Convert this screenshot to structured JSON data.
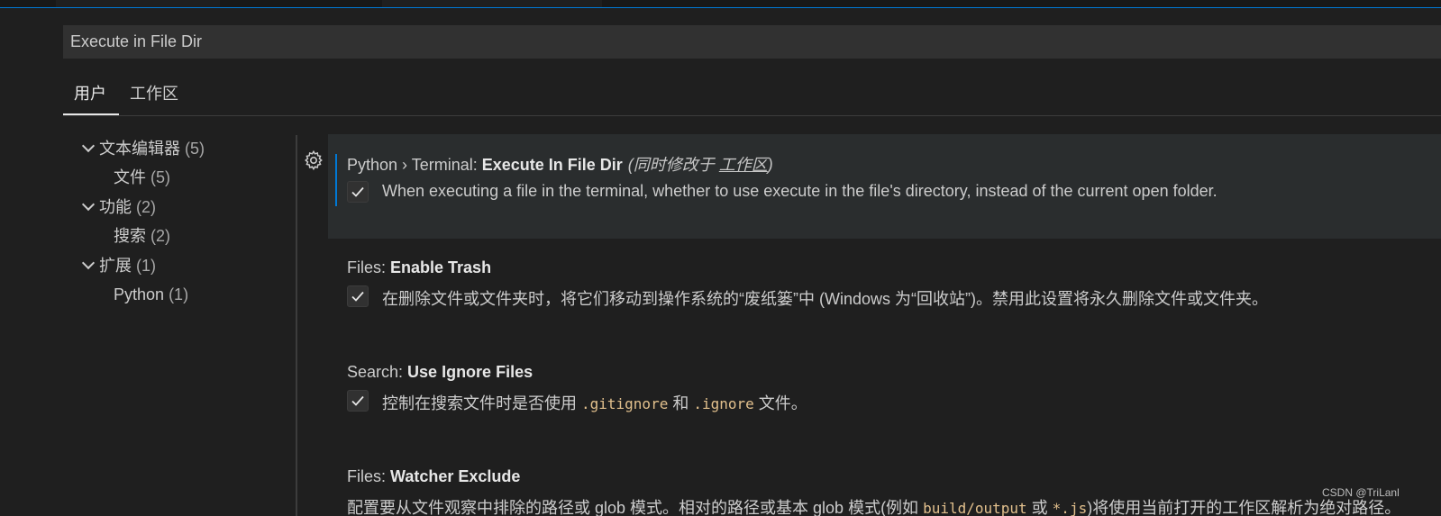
{
  "search": {
    "value": "Execute in File Dir"
  },
  "scope_tabs": [
    {
      "label": "用户",
      "active": true
    },
    {
      "label": "工作区",
      "active": false
    }
  ],
  "toc": [
    {
      "label": "文本编辑器",
      "count": "(5)",
      "expanded": true
    },
    {
      "label": "文件",
      "count": "(5)"
    },
    {
      "label": "功能",
      "count": "(2)",
      "expanded": true
    },
    {
      "label": "搜索",
      "count": "(2)"
    },
    {
      "label": "扩展",
      "count": "(1)",
      "expanded": true
    },
    {
      "label": "Python",
      "count": "(1)"
    }
  ],
  "settings": [
    {
      "category": "Python › Terminal: ",
      "key": "Execute In File Dir",
      "also_prefix": "(同时修改于 ",
      "also_link": "工作区",
      "also_suffix": ")",
      "checked": true,
      "description": "When executing a file in the terminal, whether to use execute in the file's directory, instead of the current open folder."
    },
    {
      "category": "Files: ",
      "key": "Enable Trash",
      "checked": true,
      "description": "在删除文件或文件夹时，将它们移动到操作系统的“废纸篓”中 (Windows 为“回收站”)。禁用此设置将永久删除文件或文件夹。"
    },
    {
      "category": "Search: ",
      "key": "Use Ignore Files",
      "checked": true,
      "description_pre": "控制在搜索文件时是否使用 ",
      "code1": ".gitignore",
      "description_mid": " 和 ",
      "code2": ".ignore",
      "description_post": " 文件。"
    },
    {
      "category": "Files: ",
      "key": "Watcher Exclude",
      "description_pre": "配置要从文件观察中排除的路径或 glob 模式。相对的路径或基本 glob 模式(例如 ",
      "code1": "build/output",
      "description_mid": " 或 ",
      "code2": "*.js",
      "description_post": ")将使用当前打开的工作区解析为绝对路径。"
    }
  ],
  "watermark": "CSDN @TriLanl",
  "colors": {
    "accent": "#0078d4",
    "code": "#e2c08d",
    "background": "#1f1f1f"
  }
}
